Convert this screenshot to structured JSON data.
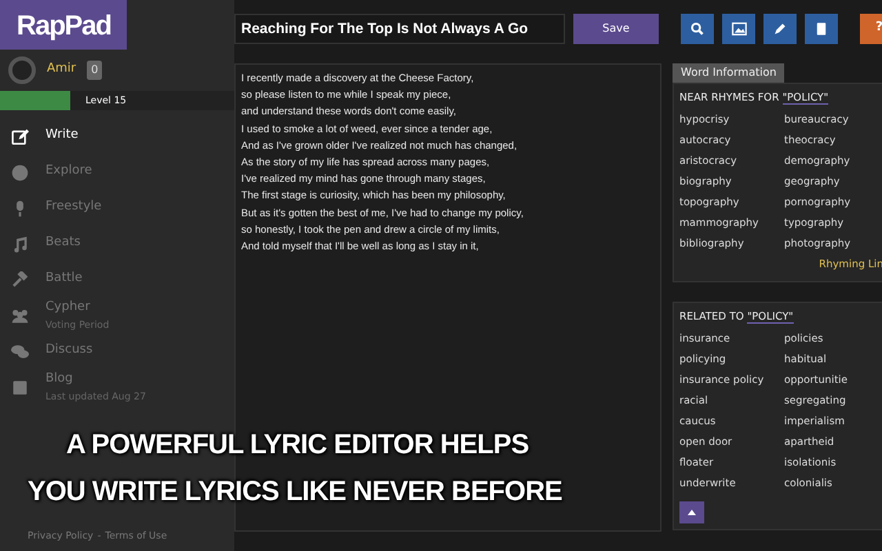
{
  "logo": "RapPad",
  "user": {
    "name": "Amir",
    "badge": "0",
    "level_label": "Level 15",
    "level": 0.3
  },
  "nav": [
    {
      "label": "Write",
      "selected": true
    },
    {
      "label": "Explore",
      "selected": false
    },
    {
      "label": "Freestyle",
      "selected": false
    },
    {
      "label": "Beats",
      "selected": false
    },
    {
      "label": "Battle",
      "selected": false
    },
    {
      "label": "Cypher",
      "subtitle": "Voting Period",
      "selected": false
    },
    {
      "label": "Discuss",
      "selected": false
    },
    {
      "label": "Blog",
      "subtitle": "Last updated Aug 27",
      "selected": false
    }
  ],
  "footer": {
    "links": [
      "Privacy Policy",
      "Terms of Use"
    ],
    "separator": "-"
  },
  "toolbar": {
    "title_value": "Reaching For The Top Is Not Always A Go",
    "save_label": "Save",
    "help_label": "?"
  },
  "editor": {
    "lines": [
      "I recently made a discovery at the Cheese Factory,",
      "so please listen to me while I speak my piece,",
      "and understand these words don't come easily,",
      "I used to smoke a lot of weed, ever since a tender age,",
      "And as I've grown older I've realized not much has changed,",
      "As the story of my life has spread across many pages,",
      "I've realized my mind has gone through many stages,",
      "The first stage is curiosity, which has been my philosophy,",
      "But as it's gotten the best of me, I've had to change my policy,",
      "so honestly, I took the pen and drew a circle of my limits,",
      "And told myself that I'll be well as long as I stay in it,"
    ]
  },
  "word_info": {
    "tab": "Word Information",
    "near_rhymes": {
      "label": "NEAR RHYMES FOR",
      "word": "\"POLICY\"",
      "words": [
        "hypocrisy",
        "bureaucracy",
        "autocracy",
        "theocracy",
        "aristocracy",
        "demography",
        "biography",
        "geography",
        "topography",
        "pornography",
        "mammography",
        "typography",
        "bibliography",
        "photography"
      ]
    },
    "rhyming_link": "Rhyming Lin",
    "related": {
      "label": "RELATED TO",
      "word": "\"POLICY\"",
      "words": [
        "insurance",
        "policies",
        "policying",
        "habitual",
        "insurance policy",
        "opportunitie",
        "racial",
        "segregating",
        "caucus",
        "imperialism",
        "open door",
        "apartheid",
        "floater",
        "isolationis",
        "underwrite",
        "colonialis"
      ]
    }
  },
  "caption": [
    "A POWERFUL LYRIC EDITOR HELPS",
    "YOU WRITE LYRICS LIKE NEVER BEFORE"
  ]
}
